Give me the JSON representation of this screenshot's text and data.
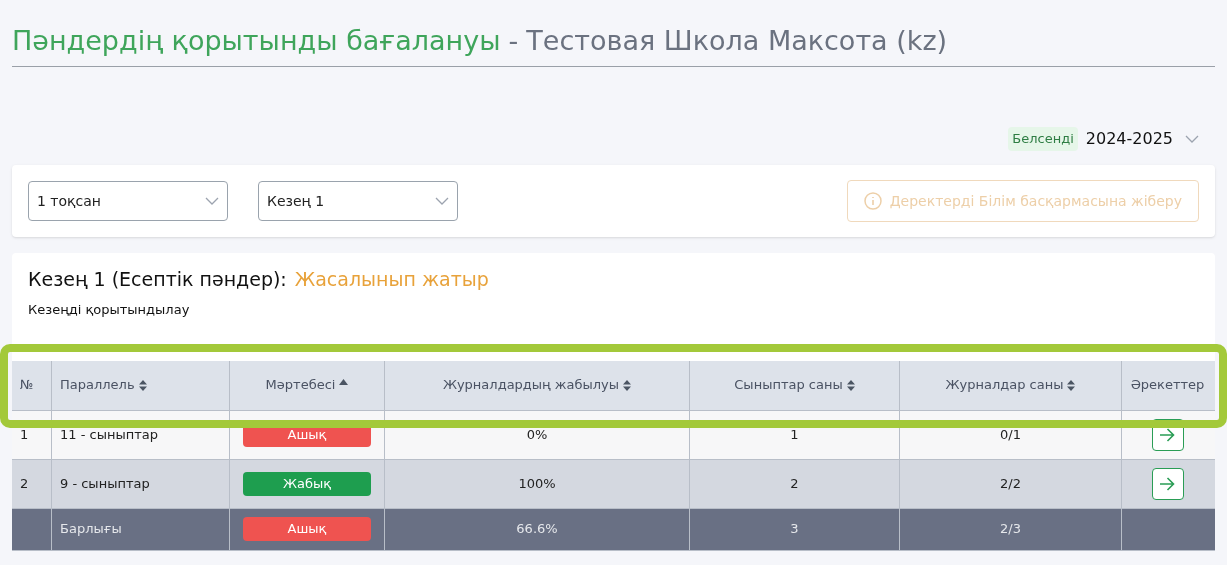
{
  "title": {
    "main": "Пәндердің қорытынды бағалануы",
    "separator": "-",
    "school": "Тестовая Школа Максота (kz)"
  },
  "year": {
    "badge": "Белсенді",
    "value": "2024-2025"
  },
  "filters": [
    {
      "value": "1 тоқсан"
    },
    {
      "value": "Кезең 1"
    }
  ],
  "send_button": {
    "label": "Деректерді Білім басқармасына жіберу",
    "disabled": true
  },
  "section": {
    "heading": "Кезең 1 (Есептік пәндер):",
    "status": "Жасалынып жатыр",
    "subtitle": "Кезеңді қорытындылау"
  },
  "table": {
    "highlighted_header": true,
    "columns": [
      {
        "label": "№",
        "kind": "plain"
      },
      {
        "label": "Параллель",
        "kind": "sortable"
      },
      {
        "label": "Мәртебесі",
        "kind": "sorted_asc"
      },
      {
        "label": "Журналдардың жабылуы",
        "kind": "sortable"
      },
      {
        "label": "Сыныптар саны",
        "kind": "sortable"
      },
      {
        "label": "Журналдар саны",
        "kind": "sortable"
      },
      {
        "label": "Әрекеттер",
        "kind": "plain"
      }
    ],
    "rows": [
      {
        "kind": "item",
        "no": "1",
        "parallel": "11 - сыныптар",
        "status": "Ашық",
        "closed": false,
        "closing": "0%",
        "classes": "1",
        "journals": "0/1",
        "action": true
      },
      {
        "kind": "item",
        "no": "2",
        "parallel": "9 - сыныптар",
        "status": "Жабық",
        "closed": true,
        "closing": "100%",
        "classes": "2",
        "journals": "2/2",
        "action": true
      },
      {
        "kind": "total",
        "parallel": "Барлығы",
        "status": "Ашық",
        "closed": false,
        "closing": "66.6%",
        "classes": "3",
        "journals": "2/3",
        "action": false
      }
    ]
  }
}
